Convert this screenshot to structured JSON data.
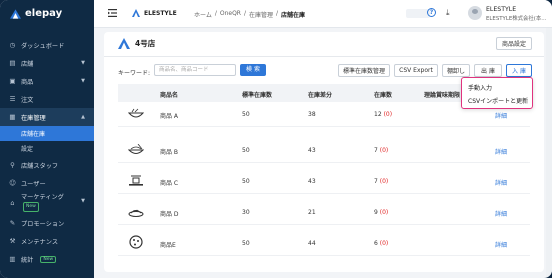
{
  "brand": {
    "name": "elepay"
  },
  "sidebar": {
    "items": [
      {
        "label": "ダッシュボード",
        "icon": "clock-icon"
      },
      {
        "label": "店舗",
        "icon": "store-icon",
        "chevron": true
      },
      {
        "label": "商品",
        "icon": "cart-icon",
        "chevron": true
      },
      {
        "label": "注文",
        "icon": "list-icon"
      },
      {
        "label": "在庫管理",
        "icon": "box-icon",
        "chevron": true
      }
    ],
    "sub_items": [
      {
        "label": "店舗在庫",
        "active": true
      },
      {
        "label": "設定",
        "active": false
      }
    ],
    "items2": [
      {
        "label": "店舗スタッフ",
        "icon": "staff-icon"
      },
      {
        "label": "ユーザー",
        "icon": "user-icon"
      },
      {
        "label": "マーケティング",
        "icon": "marketing-icon",
        "badge": "New",
        "chevron": true
      },
      {
        "label": "プロモーション",
        "icon": "promo-icon"
      },
      {
        "label": "メンテナンス",
        "icon": "wrench-icon"
      },
      {
        "label": "統計",
        "icon": "chart-icon",
        "badge": "New"
      }
    ]
  },
  "header": {
    "store_name": "ELESTYLE",
    "breadcrumb": [
      "ホーム",
      "/",
      "OneQR",
      "/",
      "在庫管理",
      "/",
      "店舗在庫"
    ],
    "user_name": "ELESTYLE",
    "user_company": "ELESTYLE株式会社(本..."
  },
  "store": {
    "title": "4号店",
    "settings_button": "商品設定"
  },
  "toolbar": {
    "keyword_label": "キーワード:",
    "search_placeholder": "商品名、商品コード",
    "search_button": "検 索",
    "btn_standard": "標準在庫数管理",
    "btn_csv_export": "CSV Export",
    "btn_stocktake": "棚卸し",
    "btn_out": "出 庫",
    "btn_in": "入 庫"
  },
  "dropdown": {
    "items": [
      "手動入力",
      "CSVインポートと更新"
    ]
  },
  "table": {
    "headers": [
      "商品名",
      "標準在庫数",
      "在庫差分",
      "在庫数",
      "理論賞味期限"
    ],
    "rows": [
      {
        "name": "商品 A",
        "standard": "50",
        "diff": "38",
        "stock": "12",
        "alert": "(0)",
        "action": "詳細",
        "thumb": "bowl-icon"
      },
      {
        "name": "商品 B",
        "standard": "50",
        "diff": "43",
        "stock": "7",
        "alert": "(0)",
        "action": "詳細",
        "thumb": "noodle-icon"
      },
      {
        "name": "商品 C",
        "standard": "50",
        "diff": "43",
        "stock": "7",
        "alert": "(0)",
        "action": "詳細",
        "thumb": "plate-icon"
      },
      {
        "name": "商品 D",
        "standard": "30",
        "diff": "21",
        "stock": "9",
        "alert": "(0)",
        "action": "詳細",
        "thumb": "cake-icon"
      },
      {
        "name": "商品E",
        "standard": "50",
        "diff": "44",
        "stock": "6",
        "alert": "(0)",
        "action": "詳細",
        "thumb": "cookie-icon"
      }
    ]
  },
  "colors": {
    "accent": "#2e77d8",
    "sidebar": "#0f2a44",
    "alert": "#e02424",
    "highlight": "#e0337e"
  }
}
